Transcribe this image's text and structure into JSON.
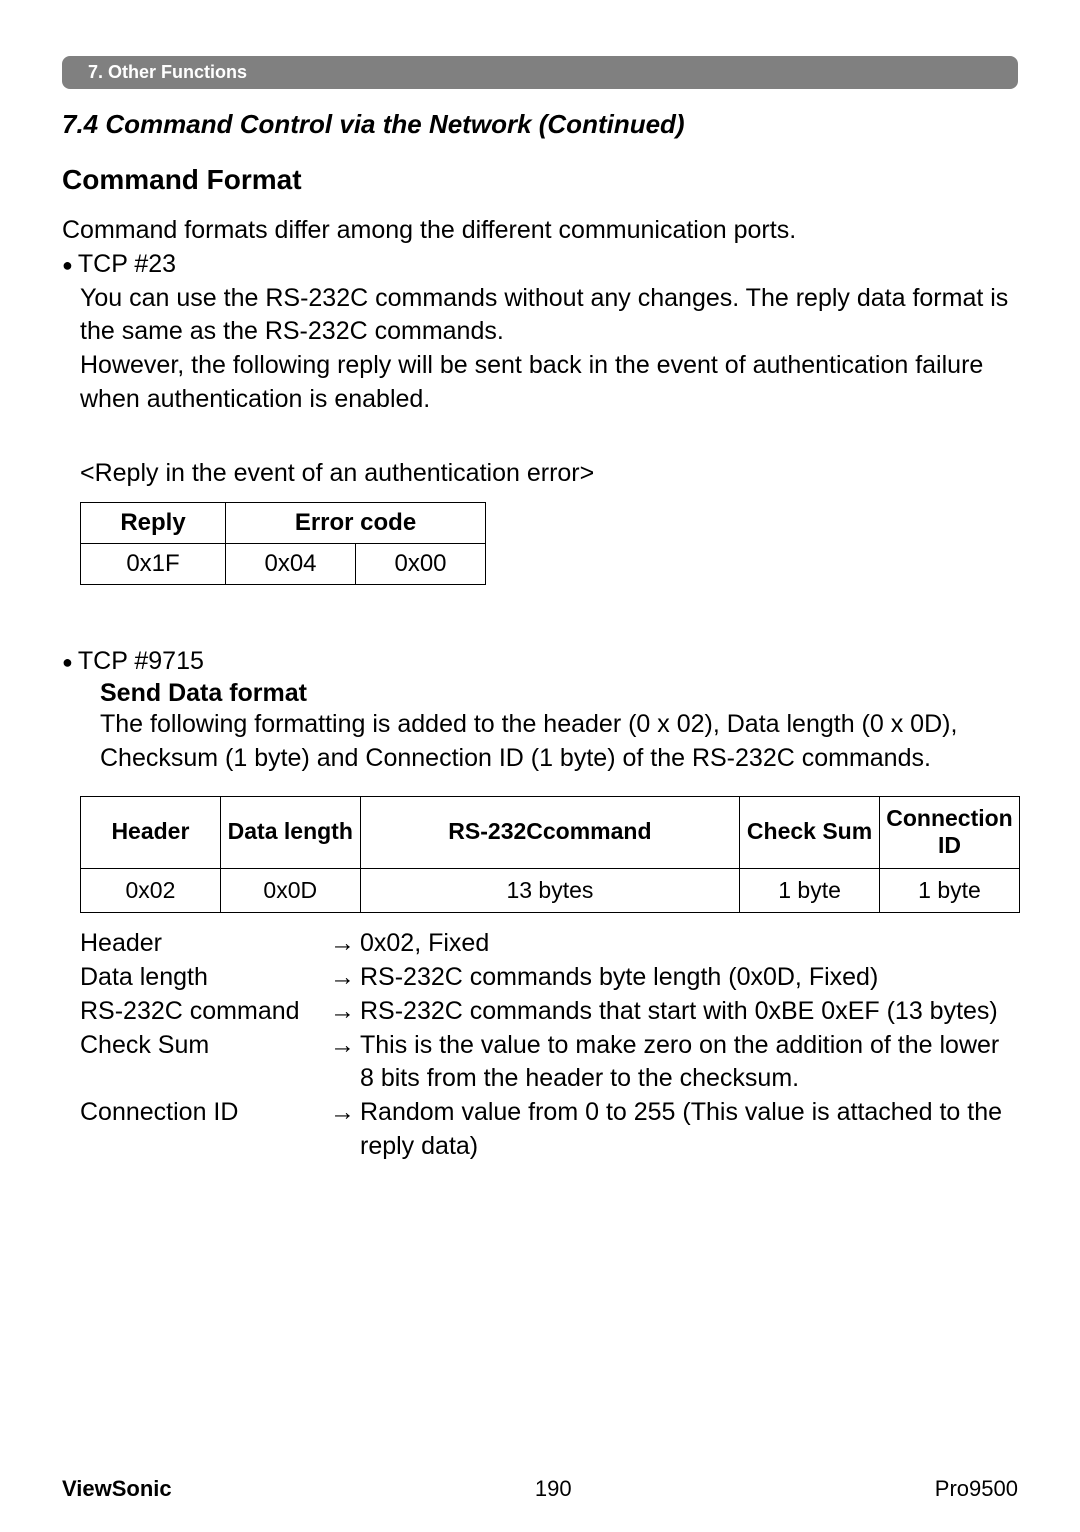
{
  "section_tab": "7. Other Functions",
  "heading_74": "7.4 Command Control via the Network (Continued)",
  "heading_command_format": "Command Format",
  "intro_line": "Command formats differ among the different communication ports.",
  "tcp23": {
    "label": "TCP #23",
    "line1": "You can use the RS-232C commands without any changes. The reply data format is the same as the RS-232C commands.",
    "line2": "However, the following reply will be sent back in the event of authentication failure when authentication is enabled.",
    "reply_caption": "<Reply in the event of an authentication error>",
    "table": {
      "h_reply": "Reply",
      "h_errorcode": "Error code",
      "r_reply": "0x1F",
      "r_err1": "0x04",
      "r_err2": "0x00"
    }
  },
  "tcp9715": {
    "label": "TCP #9715",
    "send_heading": "Send Data format",
    "send_desc": "The following formatting is added to the header (0 x 02), Data length (0 x 0D), Checksum (1 byte) and Connection ID (1 byte) of the RS-232C commands.",
    "table": {
      "h_header": "Header",
      "h_datalen": "Data length",
      "h_rs232": "RS-232Ccommand",
      "h_checksum": "Check Sum",
      "h_connid": "Connection ID",
      "r_header": "0x02",
      "r_datalen": "0x0D",
      "r_rs232": "13 bytes",
      "r_checksum": "1 byte",
      "r_connid": "1 byte"
    },
    "defs": {
      "arrow": "→",
      "header_term": "Header",
      "header_desc": "0x02, Fixed",
      "datalen_term": "Data length",
      "datalen_desc": "RS-232C commands byte length (0x0D, Fixed)",
      "rs232_term": "RS-232C command",
      "rs232_desc": "RS-232C commands that start with 0xBE 0xEF (13 bytes)",
      "checksum_term": "Check Sum",
      "checksum_desc": "This is the value to make zero on the addition of the lower 8 bits from the header to the checksum.",
      "connid_term": "Connection ID",
      "connid_desc": "Random value from 0 to 255 (This value is attached to the reply data)"
    }
  },
  "footer": {
    "brand": "ViewSonic",
    "page": "190",
    "model": "Pro9500"
  }
}
